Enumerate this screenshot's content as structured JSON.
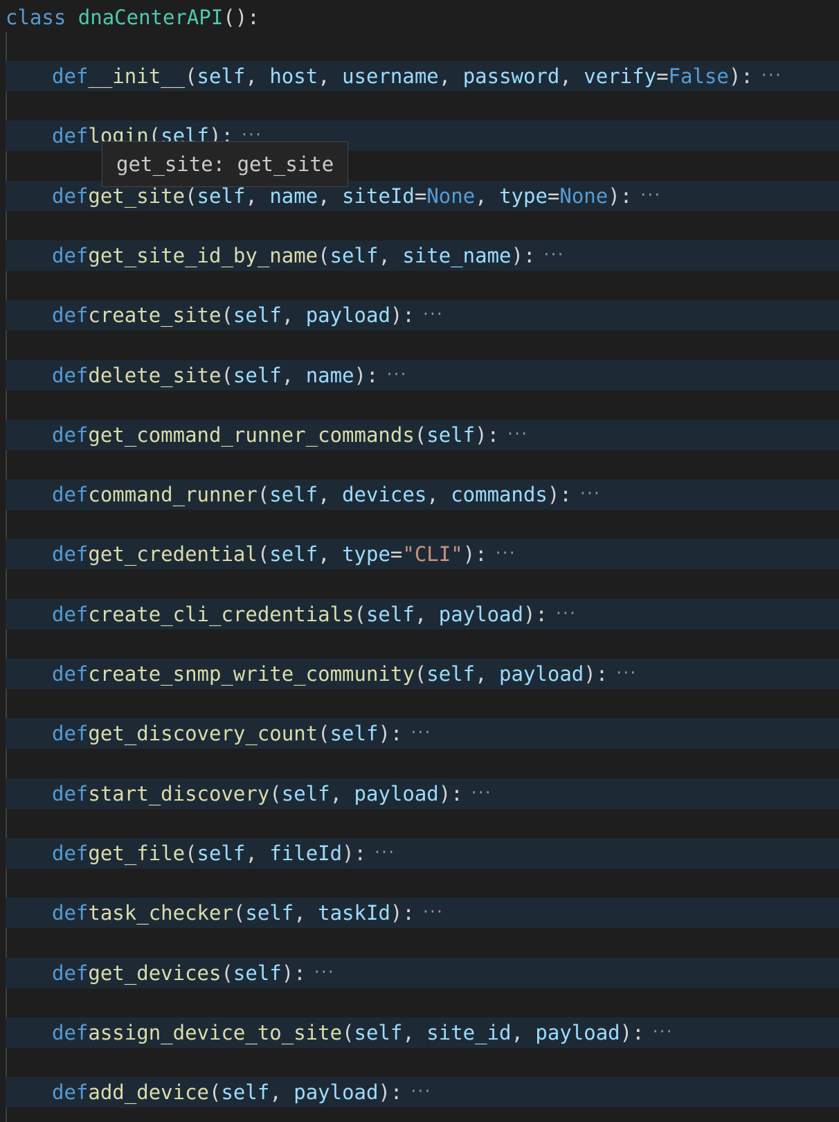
{
  "class_line": {
    "keyword": "class",
    "name": "dnaCenterAPI",
    "rest": "():"
  },
  "tooltip": {
    "text": "get_site: get_site"
  },
  "methods": [
    {
      "name": "__init__",
      "params": [
        [
          "self"
        ],
        [
          "host"
        ],
        [
          "username"
        ],
        [
          "password"
        ],
        [
          "verify",
          "=",
          "False",
          "const"
        ]
      ]
    },
    {
      "name": "login",
      "params": [
        [
          "self"
        ]
      ]
    },
    {
      "name": "get_site",
      "params": [
        [
          "self"
        ],
        [
          "name"
        ],
        [
          "siteId",
          "=",
          "None",
          "const"
        ],
        [
          "type",
          "=",
          "None",
          "const"
        ]
      ]
    },
    {
      "name": "get_site_id_by_name",
      "params": [
        [
          "self"
        ],
        [
          "site_name"
        ]
      ]
    },
    {
      "name": "create_site",
      "params": [
        [
          "self"
        ],
        [
          "payload"
        ]
      ]
    },
    {
      "name": "delete_site",
      "params": [
        [
          "self"
        ],
        [
          "name"
        ]
      ]
    },
    {
      "name": "get_command_runner_commands",
      "params": [
        [
          "self"
        ]
      ]
    },
    {
      "name": "command_runner",
      "params": [
        [
          "self"
        ],
        [
          "devices"
        ],
        [
          "commands"
        ]
      ]
    },
    {
      "name": "get_credential",
      "params": [
        [
          "self"
        ],
        [
          "type",
          "=",
          "\"CLI\"",
          "str"
        ]
      ]
    },
    {
      "name": "create_cli_credentials",
      "params": [
        [
          "self"
        ],
        [
          "payload"
        ]
      ]
    },
    {
      "name": "create_snmp_write_community",
      "params": [
        [
          "self"
        ],
        [
          "payload"
        ]
      ]
    },
    {
      "name": "get_discovery_count",
      "params": [
        [
          "self"
        ]
      ]
    },
    {
      "name": "start_discovery",
      "params": [
        [
          "self"
        ],
        [
          "payload"
        ]
      ]
    },
    {
      "name": "get_file",
      "params": [
        [
          "self"
        ],
        [
          "fileId"
        ]
      ]
    },
    {
      "name": "task_checker",
      "params": [
        [
          "self"
        ],
        [
          "taskId"
        ]
      ]
    },
    {
      "name": "get_devices",
      "params": [
        [
          "self"
        ]
      ]
    },
    {
      "name": "assign_device_to_site",
      "params": [
        [
          "self"
        ],
        [
          "site_id"
        ],
        [
          "payload"
        ]
      ]
    },
    {
      "name": "add_device",
      "params": [
        [
          "self"
        ],
        [
          "payload"
        ]
      ]
    }
  ],
  "def_keyword": "def",
  "fold_marker": "···",
  "colors": {
    "background": "#1e1e1e",
    "folded_line": "#1d2a36",
    "keyword": "#569cd6",
    "class_name": "#4ec9b0",
    "function": "#dcdcaa",
    "parameter": "#9cdcfe",
    "string": "#ce9178"
  }
}
